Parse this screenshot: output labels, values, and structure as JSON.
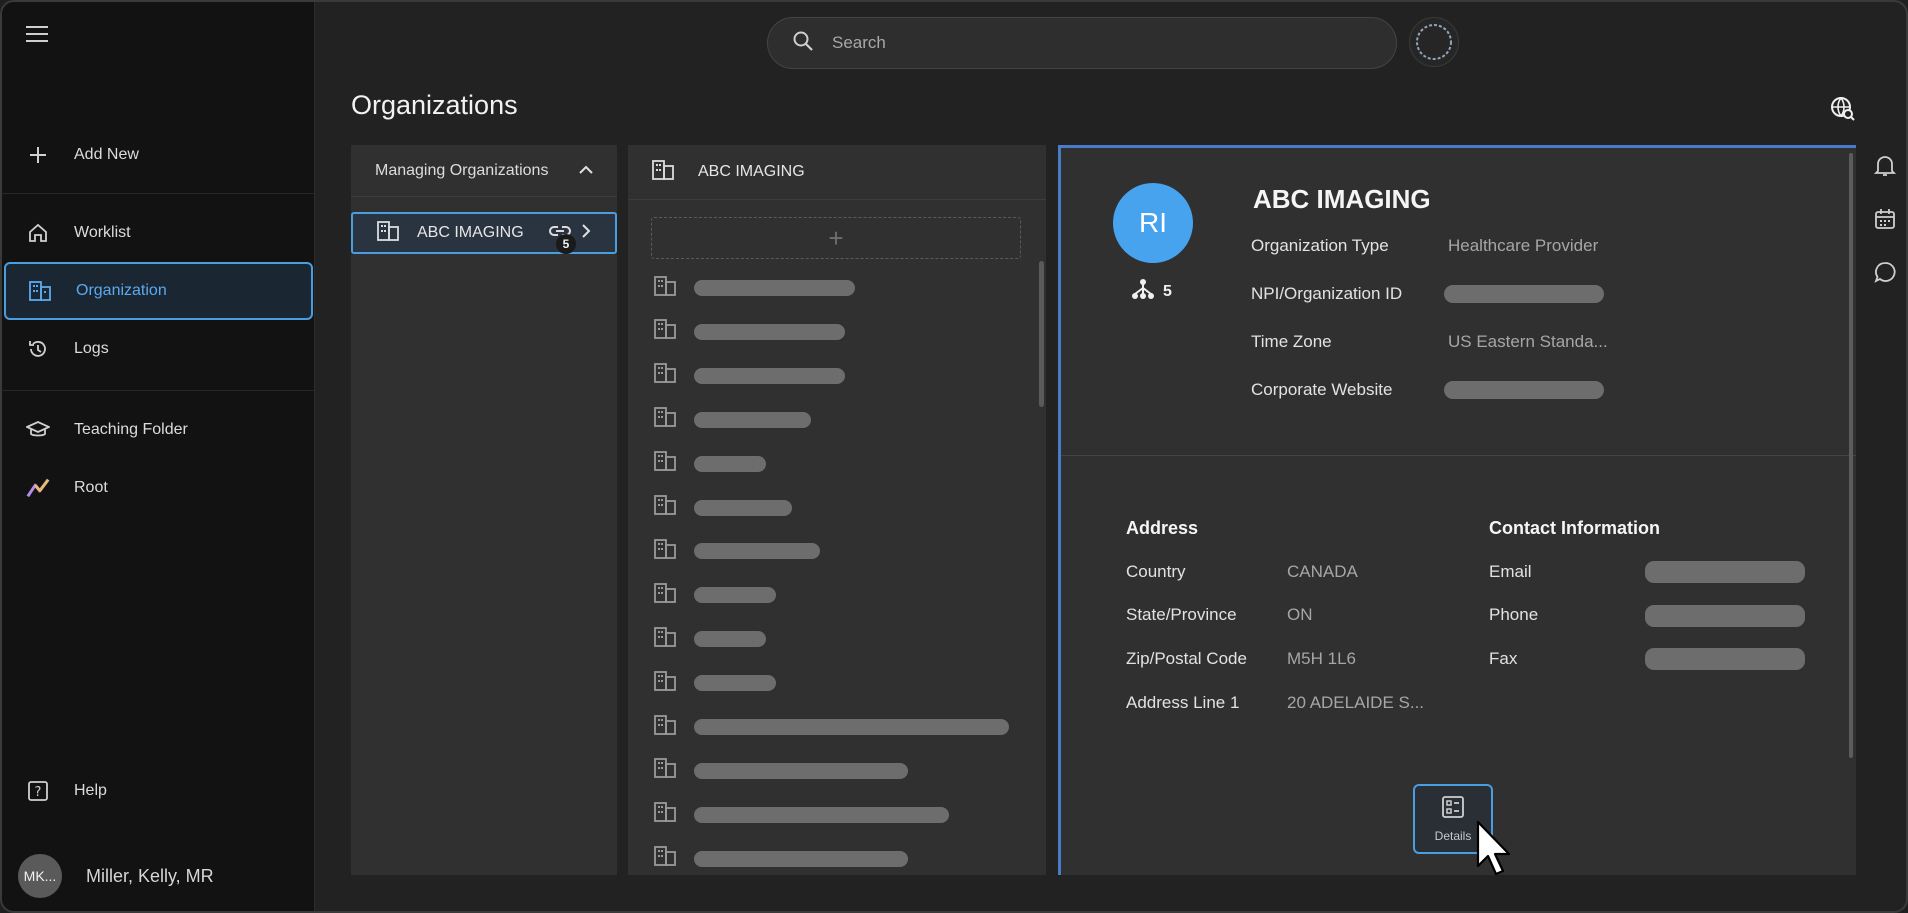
{
  "sidebar": {
    "items": [
      {
        "label": "Add New",
        "icon": "plus-icon"
      },
      {
        "label": "Worklist",
        "icon": "home-icon"
      },
      {
        "label": "Organization",
        "icon": "building-icon"
      },
      {
        "label": "Logs",
        "icon": "history-icon"
      },
      {
        "label": "Teaching Folder",
        "icon": "graduation-cap-icon"
      },
      {
        "label": "Root",
        "icon": "root-logo-icon"
      }
    ],
    "help_label": "Help",
    "user": {
      "initials": "MK...",
      "name": "Miller, Kelly, MR"
    }
  },
  "header": {
    "search_placeholder": "Search",
    "page_title": "Organizations"
  },
  "managing_panel": {
    "title": "Managing Organizations",
    "selected_org": {
      "label": "ABC IMAGING",
      "badge_count": "5"
    }
  },
  "child_panel": {
    "title": "ABC IMAGING",
    "add_symbol": "+",
    "rows": [
      {
        "bar": 0.51
      },
      {
        "bar": 0.48
      },
      {
        "bar": 0.48
      },
      {
        "bar": 0.37
      },
      {
        "bar": 0.23
      },
      {
        "bar": 0.31
      },
      {
        "bar": 0.4
      },
      {
        "bar": 0.26
      },
      {
        "bar": 0.23
      },
      {
        "bar": 0.26
      },
      {
        "bar": 1.0
      },
      {
        "bar": 0.68
      },
      {
        "bar": 0.81
      },
      {
        "bar": 0.68
      }
    ]
  },
  "detail": {
    "initials": "RI",
    "child_count": "5",
    "name": "ABC IMAGING",
    "fields": {
      "org_type_label": "Organization Type",
      "org_type_value": "Healthcare Provider",
      "npi_label": "NPI/Organization ID",
      "tz_label": "Time Zone",
      "tz_value": "US Eastern Standa...",
      "website_label": "Corporate Website"
    },
    "address": {
      "title": "Address",
      "country_label": "Country",
      "country_value": "CANADA",
      "state_label": "State/Province",
      "state_value": "ON",
      "zip_label": "Zip/Postal Code",
      "zip_value": "M5H 1L6",
      "line1_label": "Address Line 1",
      "line1_value": "20 ADELAIDE S..."
    },
    "contact": {
      "title": "Contact Information",
      "email_label": "Email",
      "phone_label": "Phone",
      "fax_label": "Fax"
    },
    "details_button": "Details"
  },
  "colors": {
    "accent": "#4a9ee0",
    "avatar": "#47a3ee"
  }
}
